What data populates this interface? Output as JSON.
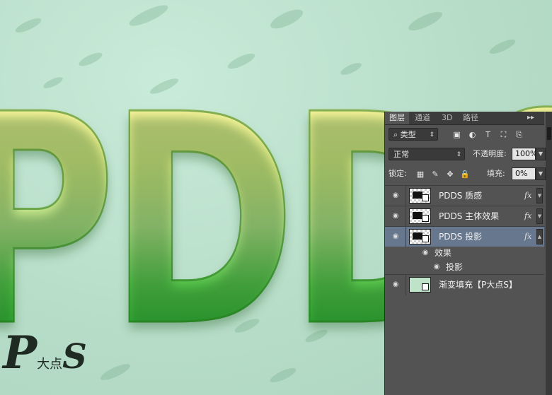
{
  "canvas": {
    "letters": "PDDS",
    "watermark": {
      "p": "P",
      "text": "大点",
      "s": "S"
    }
  },
  "panel": {
    "tabs": [
      "图层",
      "通道",
      "3D",
      "路径"
    ],
    "menu_glyph": "▸▸",
    "filter": {
      "type_label": "类型",
      "icons": [
        "image-filter-icon",
        "adjustment-filter-icon",
        "type-filter-icon",
        "shape-filter-icon",
        "smart-object-filter-icon"
      ]
    },
    "blend_mode": "正常",
    "opacity_label": "不透明度:",
    "opacity_value": "100%",
    "lock_label": "锁定:",
    "fill_label": "填充:",
    "fill_value": "0%",
    "layers": [
      {
        "name": "PDDS 质感",
        "fx": "fx"
      },
      {
        "name": "PDDS 主体效果",
        "fx": "fx"
      },
      {
        "name": "PDDS 投影",
        "fx": "fx",
        "selected": true
      }
    ],
    "effects": {
      "group_label": "效果",
      "items": [
        "投影"
      ]
    },
    "fill_layer_name": "渐变填充【P大点S】"
  },
  "colors": {
    "panel_bg": "#535353",
    "selection": "#66778e",
    "canvas_bg": "#bfe3cf"
  }
}
